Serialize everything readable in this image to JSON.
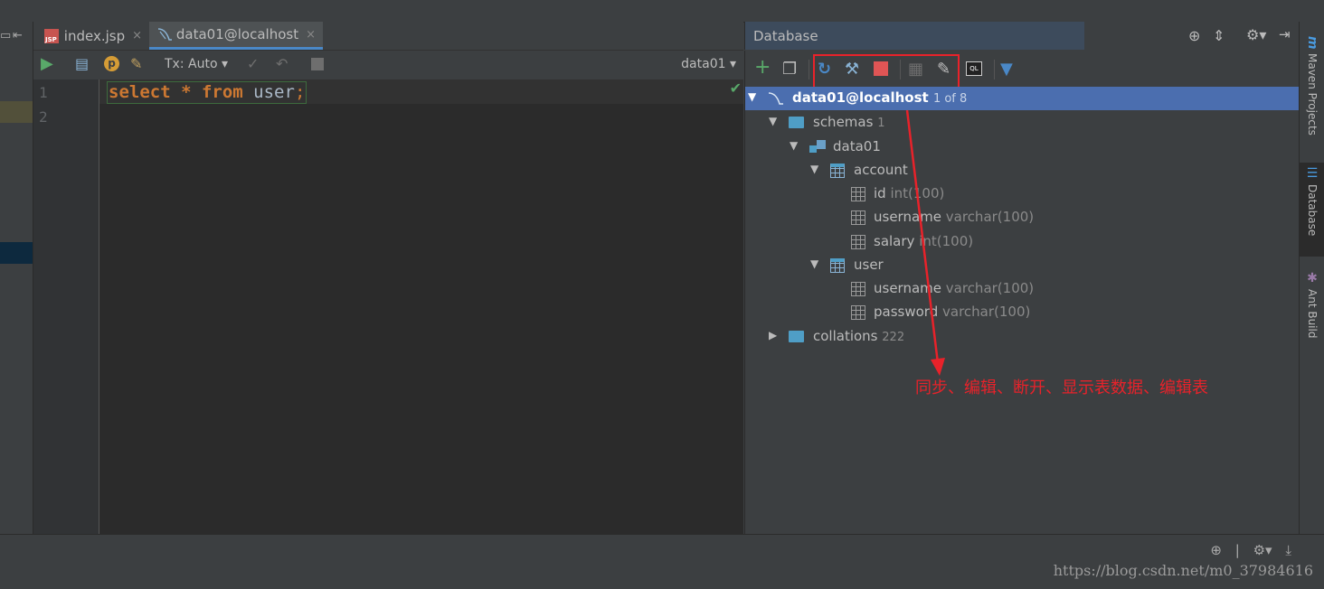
{
  "left_panel": {
    "icons": [
      "split-icon",
      "collapse-left-icon"
    ]
  },
  "tabs": [
    {
      "label": "index.jsp",
      "icon": "jsp-file-icon",
      "close": "×"
    },
    {
      "label": "data01@localhost",
      "icon": "mysql-icon",
      "close": "×"
    }
  ],
  "editor_toolbar": {
    "tx_mode": "Tx: Auto",
    "schema_selector": "data01"
  },
  "editor": {
    "line_numbers": [
      "1",
      "2"
    ],
    "tokens": [
      {
        "text": "select",
        "kind": "keyword"
      },
      {
        "text": " * ",
        "kind": "keyword"
      },
      {
        "text": "from",
        "kind": "keyword"
      },
      {
        "text": " user",
        "kind": "identifier"
      },
      {
        "text": ";",
        "kind": "keyword"
      }
    ],
    "status_glyph": "✔"
  },
  "database_panel": {
    "title": "Database",
    "tree": {
      "root": {
        "label": "data01@localhost",
        "count": "1 of 8"
      },
      "schemas": {
        "label": "schemas",
        "count": "1"
      },
      "schema": {
        "label": "data01"
      },
      "tables": [
        {
          "name": "account",
          "columns": [
            {
              "name": "id",
              "type": "int(100)"
            },
            {
              "name": "username",
              "type": "varchar(100)"
            },
            {
              "name": "salary",
              "type": "int(100)"
            }
          ]
        },
        {
          "name": "user",
          "columns": [
            {
              "name": "username",
              "type": "varchar(100)"
            },
            {
              "name": "password",
              "type": "varchar(100)"
            }
          ]
        }
      ],
      "collations": {
        "label": "collations",
        "count": "222"
      }
    },
    "annotation": "同步、编辑、断开、显示表数据、编辑表"
  },
  "right_stripe": {
    "tabs": [
      {
        "label": "Maven Projects",
        "icon": "maven-icon"
      },
      {
        "label": "Database",
        "icon": "database-icon",
        "active": true
      },
      {
        "label": "Ant Build",
        "icon": "ant-icon"
      }
    ]
  },
  "watermark": "https://blog.csdn.net/m0_37984616",
  "colors": {
    "accent": "#4a88c7",
    "selection": "#4b6eaf",
    "annotation": "#e8222a",
    "keyword": "#cc7832"
  }
}
